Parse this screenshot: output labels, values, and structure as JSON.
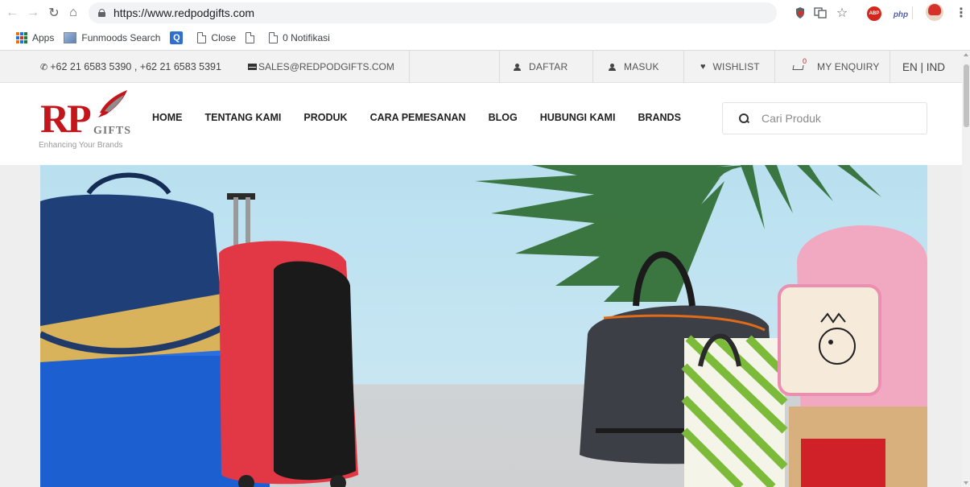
{
  "browser": {
    "url": "https://www.redpodgifts.com",
    "bookmarks": [
      {
        "label": "Apps",
        "icon": "apps-grid-icon"
      },
      {
        "label": "Funmoods Search",
        "icon": "funmoods-icon"
      },
      {
        "label": "",
        "icon": "blue-search-icon"
      },
      {
        "label": "Close",
        "icon": "page-icon"
      },
      {
        "label": "",
        "icon": "page-icon"
      },
      {
        "label": "0 Notifikasi",
        "icon": "page-icon"
      }
    ],
    "extensions": {
      "adblock_label": "ABP",
      "php_label": "php"
    }
  },
  "topbar": {
    "phone": "+62 21 6583 5390 , +62 21 6583 5391",
    "email": "SALES@REDPODGIFTS.COM",
    "register": "DAFTAR",
    "login": "MASUK",
    "wishlist": "WISHLIST",
    "enquiry": "MY ENQUIRY",
    "enquiry_count": "0",
    "language": "EN | IND"
  },
  "header": {
    "logo_letters": "RP",
    "logo_gifts": "GIFTS",
    "logo_tagline": "Enhancing Your Brands",
    "menu": [
      "HOME",
      "TENTANG KAMI",
      "PRODUK",
      "CARA PEMESANAN",
      "BLOG",
      "HUBUNGI KAMI",
      "BRANDS"
    ],
    "search_placeholder": "Cari Produk"
  },
  "colors": {
    "brand_red": "#c3161c",
    "topbar_bg": "#f2f2f2",
    "hero_sky": "#b9e0f0"
  }
}
